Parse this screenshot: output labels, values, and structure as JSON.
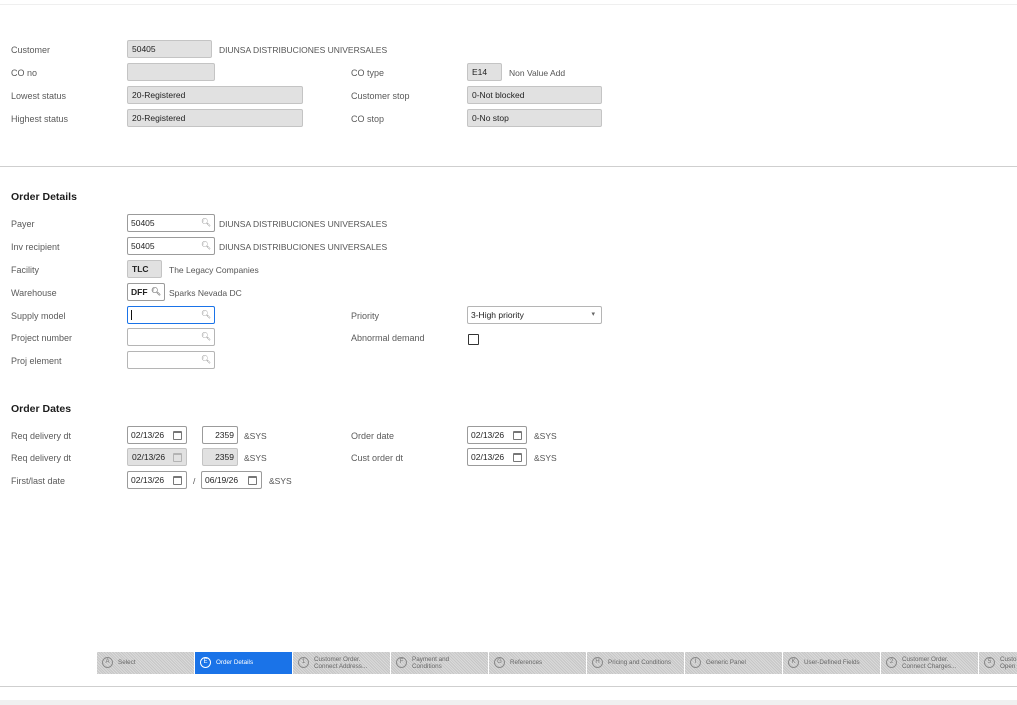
{
  "header": {
    "customer_label": "Customer",
    "customer_value": "50405",
    "customer_name": "DIUNSA DISTRIBUCIONES UNIVERSALES",
    "co_no_label": "CO no",
    "co_no_value": "",
    "co_type_label": "CO type",
    "co_type_value": "E14",
    "co_type_desc": "Non Value Add",
    "lowest_status_label": "Lowest status",
    "lowest_status_value": "20-Registered",
    "customer_stop_label": "Customer stop",
    "customer_stop_value": "0-Not blocked",
    "highest_status_label": "Highest status",
    "highest_status_value": "20-Registered",
    "co_stop_label": "CO stop",
    "co_stop_value": "0-No stop"
  },
  "order_details": {
    "title": "Order Details",
    "payer_label": "Payer",
    "payer_value": "50405",
    "payer_name": "DIUNSA DISTRIBUCIONES UNIVERSALES",
    "inv_recipient_label": "Inv recipient",
    "inv_recipient_value": "50405",
    "inv_recipient_name": "DIUNSA DISTRIBUCIONES UNIVERSALES",
    "facility_label": "Facility",
    "facility_value": "TLC",
    "facility_name": "The Legacy Companies",
    "warehouse_label": "Warehouse",
    "warehouse_value": "DFF",
    "warehouse_name": "Sparks Nevada DC",
    "supply_model_label": "Supply model",
    "supply_model_value": "",
    "priority_label": "Priority",
    "priority_value": "3-High priority",
    "project_number_label": "Project number",
    "project_number_value": "",
    "abnormal_demand_label": "Abnormal demand",
    "abnormal_demand_checked": false,
    "proj_element_label": "Proj element",
    "proj_element_value": ""
  },
  "order_dates": {
    "title": "Order Dates",
    "req_delivery_label_1": "Req delivery dt",
    "req_delivery_date_1": "02/13/26",
    "req_delivery_time_1": "2359",
    "req_delivery_tz_1": "&SYS",
    "order_date_label": "Order date",
    "order_date_value": "02/13/26",
    "order_date_tz": "&SYS",
    "req_delivery_label_2": "Req delivery dt",
    "req_delivery_date_2": "02/13/26",
    "req_delivery_time_2": "2359",
    "req_delivery_tz_2": "&SYS",
    "cust_order_dt_label": "Cust order dt",
    "cust_order_dt_value": "02/13/26",
    "cust_order_dt_tz": "&SYS",
    "first_last_label": "First/last date",
    "first_date": "02/13/26",
    "separator": "/",
    "last_date": "06/19/26",
    "first_last_tz": "&SYS"
  },
  "tabs": [
    {
      "key": "A",
      "label": "Select",
      "active": false
    },
    {
      "key": "E",
      "label": "Order Details",
      "active": true
    },
    {
      "key": "1",
      "label": "Customer Order. Connect Address...",
      "active": false
    },
    {
      "key": "F",
      "label": "Payment and Conditions",
      "active": false
    },
    {
      "key": "G",
      "label": "References",
      "active": false
    },
    {
      "key": "H",
      "label": "Pricing and Conditions",
      "active": false
    },
    {
      "key": "I",
      "label": "Generic Panel",
      "active": false
    },
    {
      "key": "K",
      "label": "User-Defined Fields",
      "active": false
    },
    {
      "key": "2",
      "label": "Customer Order. Connect Charges...",
      "active": false
    },
    {
      "key": "5",
      "label": "Custo Open",
      "active": false
    }
  ],
  "colors": {
    "accent": "#1a73e8",
    "readonly_bg": "#e1e1e1"
  }
}
